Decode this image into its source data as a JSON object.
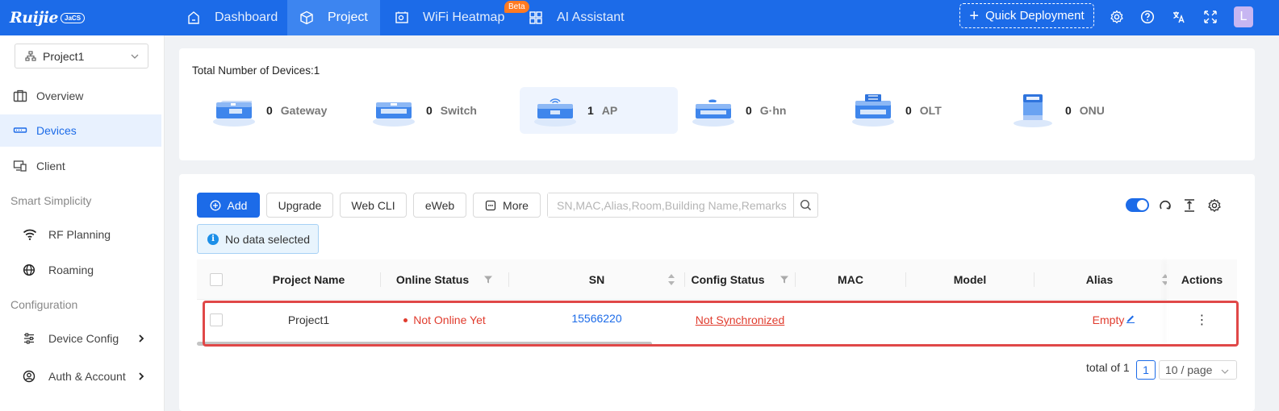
{
  "header": {
    "logo": "Ruijie",
    "logo_badge": "JaCS",
    "nav": [
      {
        "label": "Dashboard",
        "icon": "dashboard-icon"
      },
      {
        "label": "Project",
        "icon": "cube-icon",
        "active": true
      },
      {
        "label": "WiFi Heatmap",
        "icon": "heatmap-icon",
        "badge": "Beta"
      },
      {
        "label": "AI Assistant",
        "icon": "grid-icon"
      }
    ],
    "quick_deployment": "Quick Deployment",
    "avatar": "L",
    "brand_color": "#1c6be8"
  },
  "sidebar": {
    "project": "Project1",
    "items": [
      {
        "label": "Overview",
        "icon": "briefcase-icon"
      },
      {
        "label": "Devices",
        "icon": "devices-icon",
        "active": true
      },
      {
        "label": "Client",
        "icon": "client-icon"
      }
    ],
    "group_smart": "Smart Simplicity",
    "smart_items": [
      {
        "label": "RF Planning",
        "icon": "wifi-icon"
      },
      {
        "label": "Roaming",
        "icon": "globe-icon"
      }
    ],
    "group_config": "Configuration",
    "config_items": [
      {
        "label": "Device Config",
        "icon": "sliders-icon"
      },
      {
        "label": "Auth & Account",
        "icon": "user-circle-icon"
      }
    ]
  },
  "summary": {
    "total_label": "Total Number of Devices:1",
    "devices": [
      {
        "count": "0",
        "name": "Gateway"
      },
      {
        "count": "0",
        "name": "Switch"
      },
      {
        "count": "1",
        "name": "AP",
        "active": true
      },
      {
        "count": "0",
        "name": "G·hn"
      },
      {
        "count": "0",
        "name": "OLT"
      },
      {
        "count": "0",
        "name": "ONU"
      }
    ]
  },
  "toolbar": {
    "add": "Add",
    "upgrade": "Upgrade",
    "web_cli": "Web CLI",
    "eweb": "eWeb",
    "more": "More",
    "search_placeholder": "SN,MAC,Alias,Room,Building Name,Remarks"
  },
  "selection_info": "No data selected",
  "table": {
    "columns": [
      "Project Name",
      "Online Status",
      "SN",
      "Config Status",
      "MAC",
      "Model",
      "Alias",
      "Actions"
    ],
    "rows": [
      {
        "project": "Project1",
        "online_status": "Not Online Yet",
        "sn": "15566220",
        "config_status": "Not Synchronized",
        "mac": "",
        "model": "",
        "alias": "Empty",
        "actions": "⋮"
      }
    ]
  },
  "pagination": {
    "total": "total of 1",
    "current": "1",
    "page_size": "10 / page"
  },
  "colors": {
    "offline": "#e03b2d",
    "link": "#1c6be8"
  }
}
